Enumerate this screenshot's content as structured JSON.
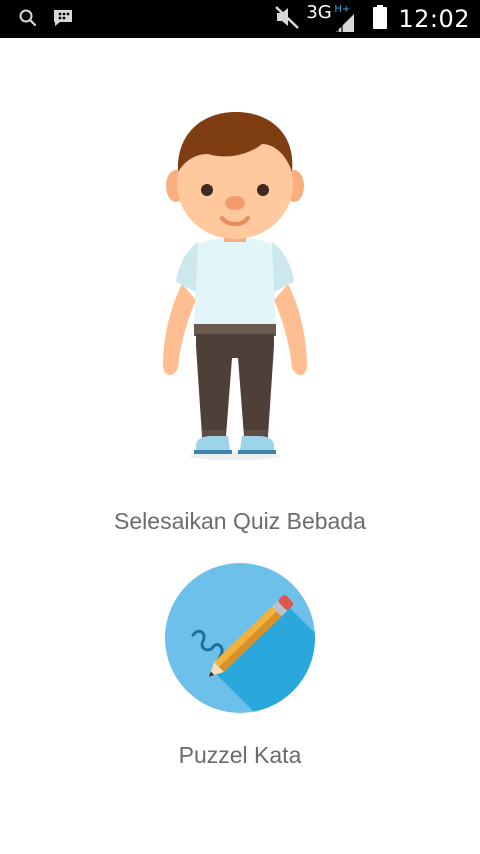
{
  "status_bar": {
    "time": "12:02",
    "network": "3G",
    "network_sub": "H+",
    "icons": [
      "search-icon",
      "bbm-icon",
      "mute-icon",
      "signal-icon",
      "battery-icon"
    ]
  },
  "main": {
    "quiz_label": "Selesaikan Quiz Bebada",
    "puzzle_label": "Puzzel Kata"
  },
  "colors": {
    "statusbar_bg": "#000000",
    "caption": "#6b6b6b",
    "circle": "#6cc0e9",
    "shadow": "#2aa8db"
  }
}
